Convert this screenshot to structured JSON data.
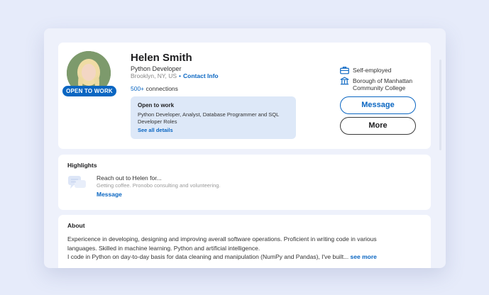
{
  "profile": {
    "name": "Helen Smith",
    "headline": "Python Developer",
    "location": "Brooklyn, NY, US",
    "separator": "•",
    "contact_info": "Contact Info",
    "connections_count": "500+",
    "connections_label": "connections",
    "open_to_work_badge": "OPEN TO WORK",
    "open_to_work": {
      "title": "Open to work",
      "roles": "Python Developer, Analyst, Database Programmer and SQL Developer Roles",
      "link": "See all details"
    },
    "employment": "Self-employed",
    "education": "Borough of Manhattan Community College",
    "message_button": "Message",
    "more_button": "More"
  },
  "highlights": {
    "title": "Highlights",
    "heading": "Reach out to Helen for...",
    "subtext": "Getting coffee. Pronobo consulting and volunteering.",
    "link": "Message"
  },
  "about": {
    "title": "About",
    "line1": "Expericence in developing, designing and improving averall software operations. Proficient in writing code in various",
    "line2": "languages. Skilled in machine learning. Python and artificial intelligence.",
    "line3": "I code in Python on day-to-day basis for data cleaning and manipulation (NumPy and Pandas), I've built...",
    "see_more": "see more"
  },
  "colors": {
    "accent": "#0a66c2",
    "page_bg": "#e6ebfa",
    "panel_bg": "#eef1fb",
    "open_to_work_bg": "#dde8f8"
  },
  "icons": {
    "briefcase": "briefcase-icon",
    "school": "school-icon",
    "chat": "chat-bubbles-icon"
  }
}
